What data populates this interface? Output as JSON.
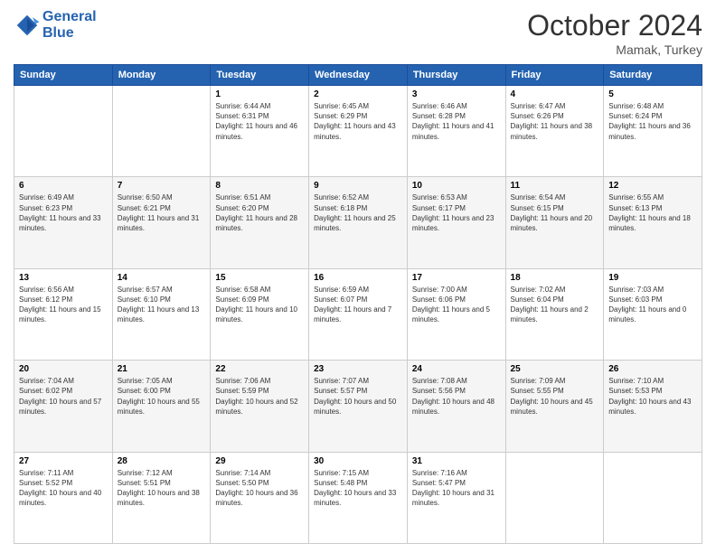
{
  "header": {
    "logo_line1": "General",
    "logo_line2": "Blue",
    "month": "October 2024",
    "location": "Mamak, Turkey"
  },
  "weekdays": [
    "Sunday",
    "Monday",
    "Tuesday",
    "Wednesday",
    "Thursday",
    "Friday",
    "Saturday"
  ],
  "weeks": [
    [
      null,
      null,
      {
        "day": "1",
        "sunrise": "6:44 AM",
        "sunset": "6:31 PM",
        "daylight": "11 hours and 46 minutes."
      },
      {
        "day": "2",
        "sunrise": "6:45 AM",
        "sunset": "6:29 PM",
        "daylight": "11 hours and 43 minutes."
      },
      {
        "day": "3",
        "sunrise": "6:46 AM",
        "sunset": "6:28 PM",
        "daylight": "11 hours and 41 minutes."
      },
      {
        "day": "4",
        "sunrise": "6:47 AM",
        "sunset": "6:26 PM",
        "daylight": "11 hours and 38 minutes."
      },
      {
        "day": "5",
        "sunrise": "6:48 AM",
        "sunset": "6:24 PM",
        "daylight": "11 hours and 36 minutes."
      }
    ],
    [
      {
        "day": "6",
        "sunrise": "6:49 AM",
        "sunset": "6:23 PM",
        "daylight": "11 hours and 33 minutes."
      },
      {
        "day": "7",
        "sunrise": "6:50 AM",
        "sunset": "6:21 PM",
        "daylight": "11 hours and 31 minutes."
      },
      {
        "day": "8",
        "sunrise": "6:51 AM",
        "sunset": "6:20 PM",
        "daylight": "11 hours and 28 minutes."
      },
      {
        "day": "9",
        "sunrise": "6:52 AM",
        "sunset": "6:18 PM",
        "daylight": "11 hours and 25 minutes."
      },
      {
        "day": "10",
        "sunrise": "6:53 AM",
        "sunset": "6:17 PM",
        "daylight": "11 hours and 23 minutes."
      },
      {
        "day": "11",
        "sunrise": "6:54 AM",
        "sunset": "6:15 PM",
        "daylight": "11 hours and 20 minutes."
      },
      {
        "day": "12",
        "sunrise": "6:55 AM",
        "sunset": "6:13 PM",
        "daylight": "11 hours and 18 minutes."
      }
    ],
    [
      {
        "day": "13",
        "sunrise": "6:56 AM",
        "sunset": "6:12 PM",
        "daylight": "11 hours and 15 minutes."
      },
      {
        "day": "14",
        "sunrise": "6:57 AM",
        "sunset": "6:10 PM",
        "daylight": "11 hours and 13 minutes."
      },
      {
        "day": "15",
        "sunrise": "6:58 AM",
        "sunset": "6:09 PM",
        "daylight": "11 hours and 10 minutes."
      },
      {
        "day": "16",
        "sunrise": "6:59 AM",
        "sunset": "6:07 PM",
        "daylight": "11 hours and 7 minutes."
      },
      {
        "day": "17",
        "sunrise": "7:00 AM",
        "sunset": "6:06 PM",
        "daylight": "11 hours and 5 minutes."
      },
      {
        "day": "18",
        "sunrise": "7:02 AM",
        "sunset": "6:04 PM",
        "daylight": "11 hours and 2 minutes."
      },
      {
        "day": "19",
        "sunrise": "7:03 AM",
        "sunset": "6:03 PM",
        "daylight": "11 hours and 0 minutes."
      }
    ],
    [
      {
        "day": "20",
        "sunrise": "7:04 AM",
        "sunset": "6:02 PM",
        "daylight": "10 hours and 57 minutes."
      },
      {
        "day": "21",
        "sunrise": "7:05 AM",
        "sunset": "6:00 PM",
        "daylight": "10 hours and 55 minutes."
      },
      {
        "day": "22",
        "sunrise": "7:06 AM",
        "sunset": "5:59 PM",
        "daylight": "10 hours and 52 minutes."
      },
      {
        "day": "23",
        "sunrise": "7:07 AM",
        "sunset": "5:57 PM",
        "daylight": "10 hours and 50 minutes."
      },
      {
        "day": "24",
        "sunrise": "7:08 AM",
        "sunset": "5:56 PM",
        "daylight": "10 hours and 48 minutes."
      },
      {
        "day": "25",
        "sunrise": "7:09 AM",
        "sunset": "5:55 PM",
        "daylight": "10 hours and 45 minutes."
      },
      {
        "day": "26",
        "sunrise": "7:10 AM",
        "sunset": "5:53 PM",
        "daylight": "10 hours and 43 minutes."
      }
    ],
    [
      {
        "day": "27",
        "sunrise": "7:11 AM",
        "sunset": "5:52 PM",
        "daylight": "10 hours and 40 minutes."
      },
      {
        "day": "28",
        "sunrise": "7:12 AM",
        "sunset": "5:51 PM",
        "daylight": "10 hours and 38 minutes."
      },
      {
        "day": "29",
        "sunrise": "7:14 AM",
        "sunset": "5:50 PM",
        "daylight": "10 hours and 36 minutes."
      },
      {
        "day": "30",
        "sunrise": "7:15 AM",
        "sunset": "5:48 PM",
        "daylight": "10 hours and 33 minutes."
      },
      {
        "day": "31",
        "sunrise": "7:16 AM",
        "sunset": "5:47 PM",
        "daylight": "10 hours and 31 minutes."
      },
      null,
      null
    ]
  ],
  "labels": {
    "sunrise": "Sunrise:",
    "sunset": "Sunset:",
    "daylight": "Daylight:"
  }
}
